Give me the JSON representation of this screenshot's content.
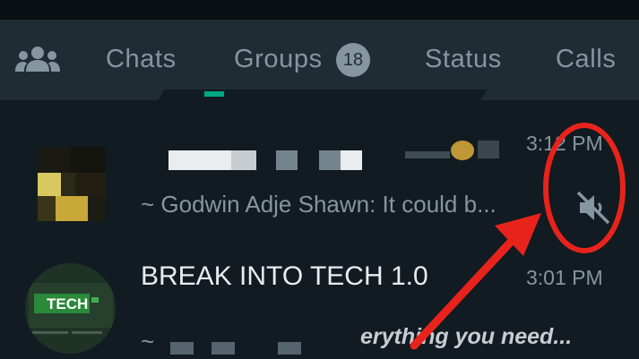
{
  "tabs": {
    "community_icon": "community-icon",
    "chats_label": "Chats",
    "groups_label": "Groups",
    "groups_badge": "18",
    "status_label": "Status",
    "calls_label": "Calls"
  },
  "chats": [
    {
      "name": "",
      "time": "3:12 PM",
      "preview": "~ Godwin Adje Shawn: It could b...",
      "muted": true,
      "mute_icon": "muted-speaker-icon"
    },
    {
      "name": "BREAK INTO TECH 1.0",
      "time": "3:01 PM",
      "preview_prefix": "~",
      "preview_suffix": "erything you need...",
      "avatar_text": "TECH"
    }
  ],
  "colors": {
    "annotation_red": "#e8231c",
    "accent_green": "#00a884",
    "header_bg": "#1f2c34",
    "app_bg": "#111b21"
  }
}
